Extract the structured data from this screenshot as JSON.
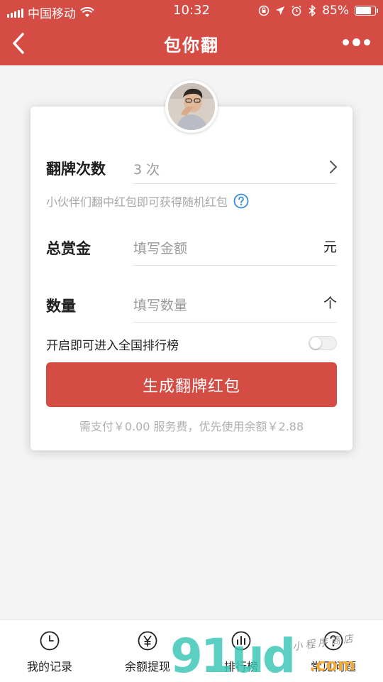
{
  "status_bar": {
    "carrier": "中国移动",
    "time": "10:32",
    "battery_percent": "85%",
    "battery_level": 0.85
  },
  "nav": {
    "title": "包你翻",
    "back_icon": "chevron-left-icon",
    "more_icon": "more-dots-icon"
  },
  "form": {
    "flip_count": {
      "label": "翻牌次数",
      "value": "3 次"
    },
    "hint": "小伙伴们翻中红包即可获得随机红包",
    "total_reward": {
      "label": "总赏金",
      "placeholder": "填写金额",
      "unit": "元"
    },
    "quantity": {
      "label": "数量",
      "placeholder": "填写数量",
      "unit": "个"
    },
    "rank_toggle": {
      "label": "开启即可进入全国排行榜",
      "on": false
    },
    "submit_label": "生成翻牌红包",
    "pay_note": "需支付￥0.00 服务费，优先使用余额￥2.88"
  },
  "tabs": [
    {
      "label": "我的记录",
      "icon": "clock-icon"
    },
    {
      "label": "余额提现",
      "icon": "yen-icon"
    },
    {
      "label": "排行榜",
      "icon": "bar-chart-icon"
    },
    {
      "label": "常见问题",
      "icon": "question-icon"
    }
  ],
  "watermark": {
    "main": "91ud",
    "suffix": ".com",
    "sub": "小程序商店"
  },
  "colors": {
    "brand_red": "#d44c44",
    "help_blue": "#3a8fd9"
  }
}
